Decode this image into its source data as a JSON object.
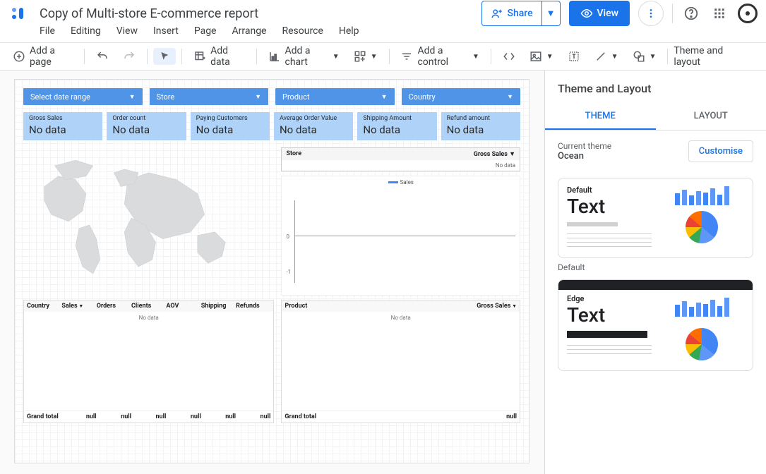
{
  "header": {
    "title": "Copy of Multi-store E-commerce report",
    "share": "Share",
    "view": "View"
  },
  "menu": [
    "File",
    "Editing",
    "View",
    "Insert",
    "Page",
    "Arrange",
    "Resource",
    "Help"
  ],
  "toolbar": {
    "add_page": "Add a page",
    "add_data": "Add data",
    "add_chart": "Add a chart",
    "add_control": "Add a control",
    "theme_layout": "Theme and layout"
  },
  "canvas": {
    "filters": [
      "Select date range",
      "Store",
      "Product",
      "Country"
    ],
    "scorecards": [
      {
        "label": "Gross Sales",
        "value": "No data"
      },
      {
        "label": "Order count",
        "value": "No data"
      },
      {
        "label": "Paying Customers",
        "value": "No data"
      },
      {
        "label": "Average Order Value",
        "value": "No data"
      },
      {
        "label": "Shipping Amount",
        "value": "No data"
      },
      {
        "label": "Refund amount",
        "value": "No data"
      }
    ],
    "store_table": {
      "col1": "Store",
      "col2": "Gross Sales",
      "nodata": "No data"
    },
    "chart_legend": "Sales",
    "axis0": "0",
    "axis1": "-1",
    "table1": {
      "cols": [
        "Country",
        "Sales",
        "Orders",
        "Clients",
        "AOV",
        "Shipping",
        "Refunds"
      ],
      "nodata": "No data",
      "footer": [
        "Grand total",
        "null",
        "null",
        "null",
        "null",
        "null",
        "null"
      ]
    },
    "table2": {
      "cols": [
        "Product",
        "Gross Sales"
      ],
      "nodata": "No data",
      "footer": [
        "Grand total",
        "null"
      ]
    }
  },
  "sidepanel": {
    "title": "Theme and Layout",
    "tabs": [
      "THEME",
      "LAYOUT"
    ],
    "current_label": "Current theme",
    "current_name": "Ocean",
    "customise": "Customise",
    "themes": [
      {
        "name": "Default",
        "text": "Text"
      },
      {
        "name": "Edge",
        "text": "Text"
      }
    ],
    "default_label": "Default"
  }
}
